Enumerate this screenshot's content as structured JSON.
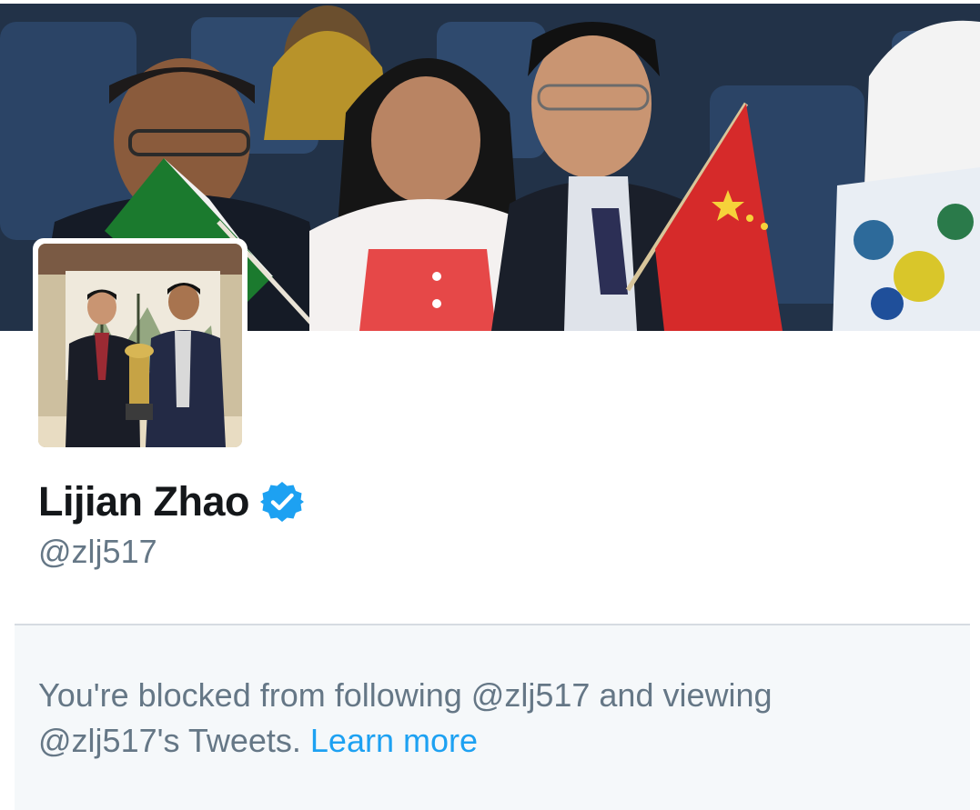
{
  "profile": {
    "display_name": "Lijian Zhao",
    "verified": true,
    "screen_name": "@zlj517"
  },
  "blocked_notice": {
    "message_part1": "You're blocked from following @zlj517 and viewing",
    "message_part2": "@zlj517's Tweets.",
    "learn_more_label": "Learn more"
  },
  "icons": {
    "verified": "verified-badge-icon"
  },
  "colors": {
    "text_primary": "#14171a",
    "text_secondary": "#657786",
    "link": "#1da1f2",
    "notice_background": "#f5f8fa",
    "verified_badge": "#1da1f2"
  }
}
